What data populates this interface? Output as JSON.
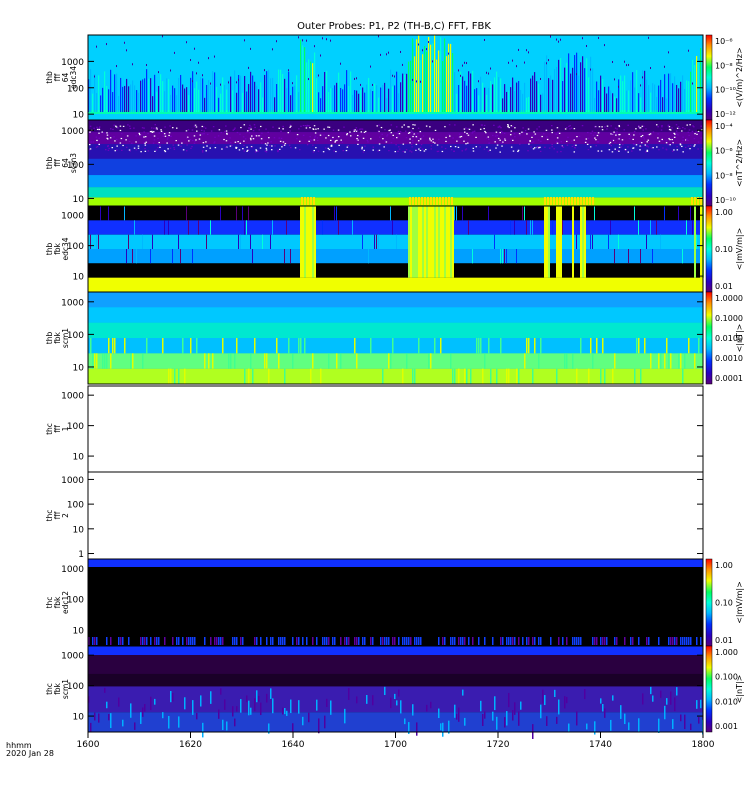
{
  "chart_data": {
    "type": "heatmap",
    "title": "Outer Probes: P1, P2 (TH-B,C) FFT, FBK",
    "time_label": "hhmm",
    "date_label": "2020 Jan 28",
    "xlim": [
      1600,
      1800
    ],
    "x_ticks": [
      "1600",
      "1620",
      "1640",
      "1700",
      "1720",
      "1740",
      "1800"
    ],
    "y_scale": "log",
    "colormap": [
      "#5a007a",
      "#2a00c0",
      "#0030ff",
      "#00b8ff",
      "#00ffd8",
      "#00ff60",
      "#f0ff00",
      "#ff9000",
      "#ff0000"
    ],
    "panels": [
      {
        "id": "thb-fff-64-edc34",
        "ylabel": [
          "thb",
          "fff",
          "64",
          "edc34"
        ],
        "yticks": [
          "10",
          "100",
          "1000"
        ],
        "ylim": [
          6,
          10000
        ],
        "style": "fft",
        "base": "#00d0ff",
        "colorbar": {
          "label": "<(V/m)^2/Hz>",
          "ticks": [
            "10⁻⁶",
            "10⁻⁸",
            "10⁻¹⁰",
            "10⁻¹²"
          ]
        }
      },
      {
        "id": "thb-fff-64-scm3",
        "ylabel": [
          "thb",
          "fff",
          "64",
          "scm3"
        ],
        "yticks": [
          "10",
          "100",
          "1000"
        ],
        "ylim": [
          6,
          2000
        ],
        "style": "fft-dense",
        "base": "#1a28c0",
        "colorbar": {
          "label": "<nT^2/Hz>",
          "ticks": [
            "10⁻⁴",
            "10⁻⁶",
            "10⁻⁸",
            "10⁻¹⁰"
          ]
        }
      },
      {
        "id": "thb-fbk-edc34",
        "ylabel": [
          "thb",
          "fbk",
          "edc34"
        ],
        "yticks": [
          "10",
          "100",
          "1000"
        ],
        "ylim": [
          3,
          2000
        ],
        "style": "fbk-e",
        "base": "#000000",
        "colorbar": {
          "label": "<|mV/m|>",
          "ticks": [
            "1.00",
            "0.10",
            "0.01"
          ]
        }
      },
      {
        "id": "thb-fbk-scm1",
        "ylabel": [
          "thb",
          "fbk",
          "scm1"
        ],
        "yticks": [
          "10",
          "100",
          "1000"
        ],
        "ylim": [
          3,
          2000
        ],
        "style": "fbk-b",
        "base": "#00a8ff",
        "colorbar": {
          "label": "<|nT|>",
          "ticks": [
            "1.0000",
            "0.1000",
            "0.0100",
            "0.0010",
            "0.0001"
          ]
        }
      },
      {
        "id": "thc-fff-1",
        "ylabel": [
          "thc",
          "fff",
          "1"
        ],
        "yticks": [
          "10",
          "100",
          "1000"
        ],
        "ylim": [
          3,
          2000
        ],
        "style": "empty"
      },
      {
        "id": "thc-fff-2",
        "ylabel": [
          "thc",
          "fff",
          "2"
        ],
        "yticks": [
          "1",
          "10",
          "100",
          "1000"
        ],
        "ylim": [
          0.6,
          2000
        ],
        "style": "empty"
      },
      {
        "id": "thc-fbk-edc12",
        "ylabel": [
          "thc",
          "fbk",
          "edc12"
        ],
        "yticks": [
          "10",
          "100",
          "1000"
        ],
        "ylim": [
          3,
          2000
        ],
        "style": "fbk-e-thc",
        "base": "#000000",
        "colorbar": {
          "label": "<|mV/m|>",
          "ticks": [
            "1.00",
            "0.10",
            "0.01"
          ]
        }
      },
      {
        "id": "thc-fbk-scm1",
        "ylabel": [
          "thc",
          "fbk",
          "scm1"
        ],
        "yticks": [
          "10",
          "100",
          "1000"
        ],
        "ylim": [
          3,
          2000
        ],
        "style": "fbk-b-thc",
        "base": "#1a0028",
        "colorbar": {
          "label": "<|nT|>",
          "ticks": [
            "1.000",
            "0.100",
            "0.010",
            "0.001"
          ]
        }
      }
    ]
  }
}
